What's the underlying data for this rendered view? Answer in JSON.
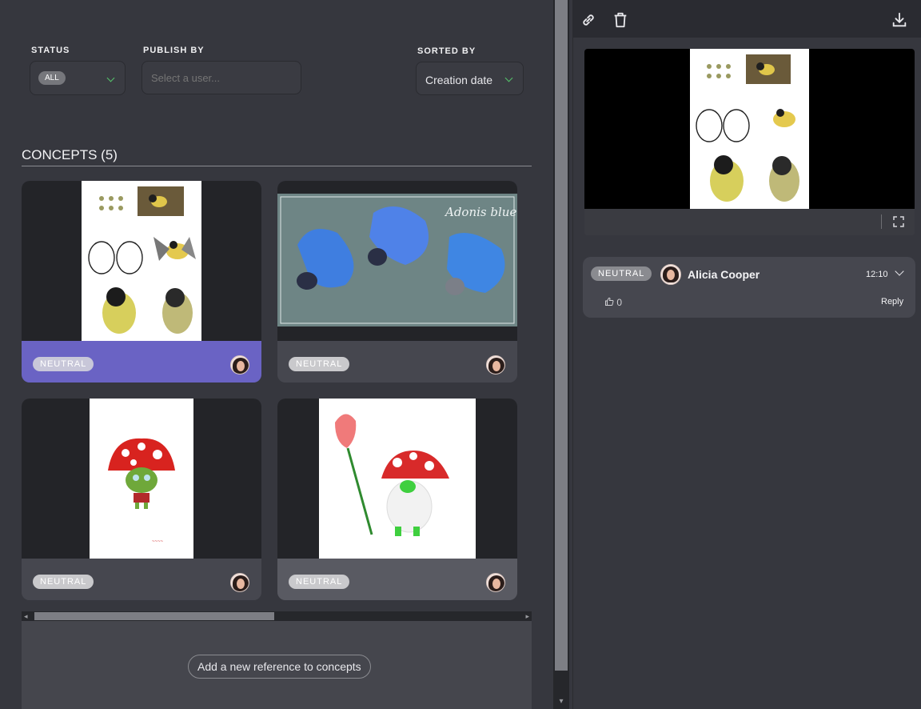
{
  "filters": {
    "status_label": "STATUS",
    "status_value": "ALL",
    "publish_label": "PUBLISH BY",
    "publish_placeholder": "Select a user...",
    "sorted_label": "SORTED BY",
    "sorted_value": "Creation date"
  },
  "section": {
    "title": "CONCEPTS (5)"
  },
  "cards": [
    {
      "status": "NEUTRAL",
      "image": "british-tits-concept-sheet",
      "state": "selected"
    },
    {
      "status": "NEUTRAL",
      "image": "adonis-blue-butterflies",
      "caption": "Adonis blue"
    },
    {
      "status": "NEUTRAL",
      "image": "mushroom-goblin-character"
    },
    {
      "status": "NEUTRAL",
      "image": "mushroom-gnome-with-rose",
      "state": "hover"
    }
  ],
  "add_reference_label": "Add a new reference to concepts",
  "detail": {
    "toolbar": {
      "link_icon": "link-icon",
      "delete_icon": "trash-icon",
      "download_icon": "download-icon"
    },
    "comment": {
      "status": "NEUTRAL",
      "author": "Alicia Cooper",
      "time": "12:10",
      "likes": "0",
      "reply_label": "Reply"
    }
  },
  "colors": {
    "selected_card": "#6a63c4",
    "accent_chevron": "#55c46b",
    "background": "#36373e"
  }
}
